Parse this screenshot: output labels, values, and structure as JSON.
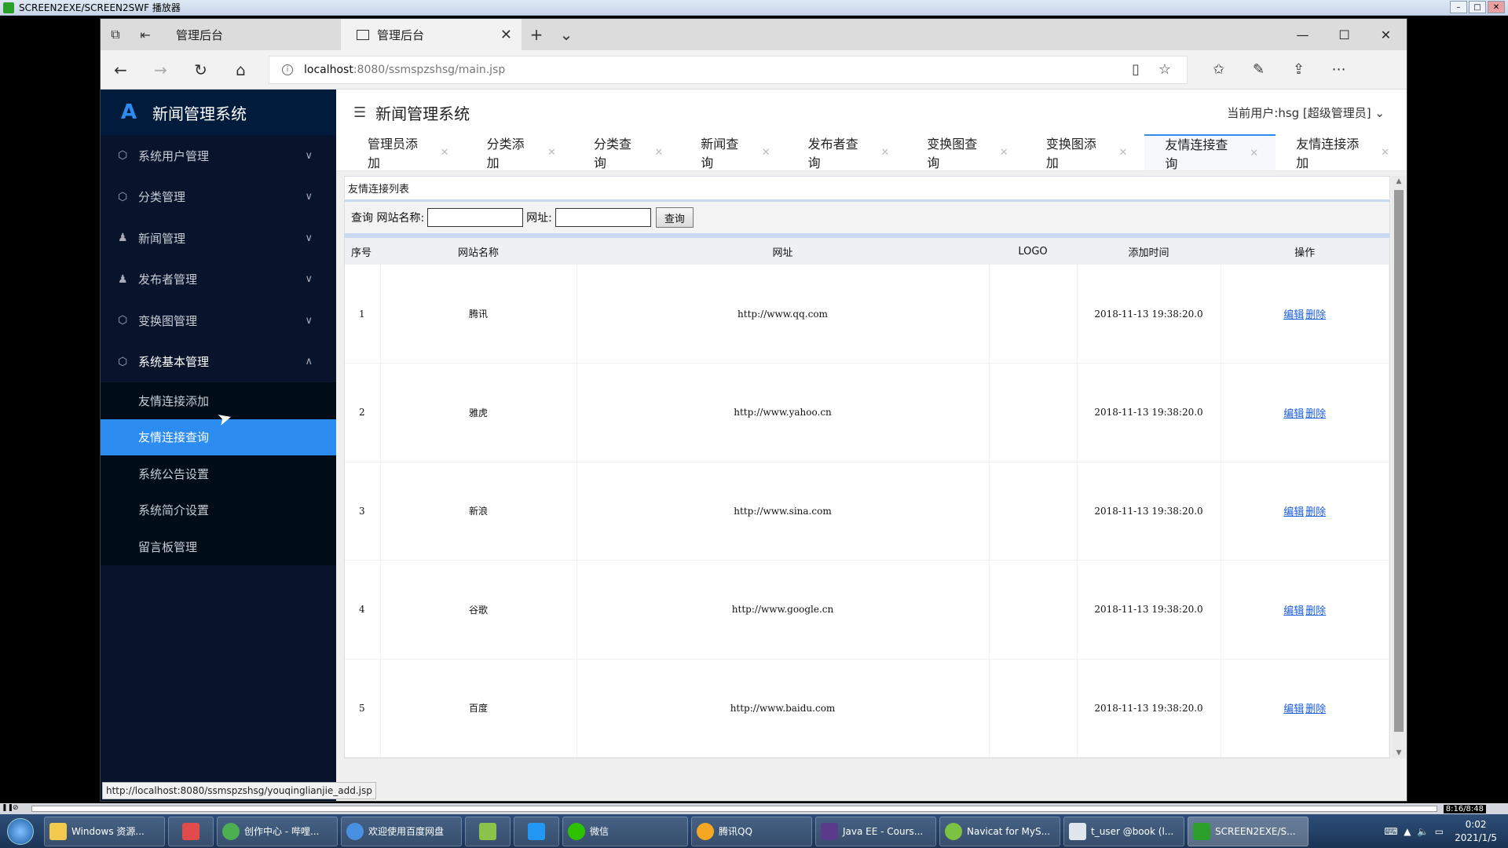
{
  "player": {
    "title": "SCREEN2EXE/SCREEN2SWF 播放器",
    "time": "8:16/8:48"
  },
  "browser": {
    "tabs": [
      {
        "label": "管理后台"
      },
      {
        "label": "管理后台"
      }
    ],
    "url_host": "localhost",
    "url_path": ":8080/ssmspzshsg/main.jsp",
    "status_url": "http://localhost:8080/ssmspzshsg/youqinglianjie_add.jsp"
  },
  "app": {
    "logo_text": "新闻管理系统",
    "header_title": "新闻管理系统",
    "current_user": "当前用户:hsg [超级管理员]",
    "menu": [
      {
        "label": "系统用户管理",
        "icon": "cube-icon"
      },
      {
        "label": "分类管理",
        "icon": "cube-icon"
      },
      {
        "label": "新闻管理",
        "icon": "user-icon"
      },
      {
        "label": "发布者管理",
        "icon": "user-icon"
      },
      {
        "label": "变换图管理",
        "icon": "cube-icon"
      },
      {
        "label": "系统基本管理",
        "icon": "cube-icon"
      }
    ],
    "submenu": [
      {
        "label": "友情连接添加"
      },
      {
        "label": "友情连接查询"
      },
      {
        "label": "系统公告设置"
      },
      {
        "label": "系统简介设置"
      },
      {
        "label": "留言板管理"
      }
    ],
    "nav_tabs": [
      {
        "label": "管理员添加"
      },
      {
        "label": "分类添加"
      },
      {
        "label": "分类查询"
      },
      {
        "label": "新闻查询"
      },
      {
        "label": "发布者查询"
      },
      {
        "label": "变换图查询"
      },
      {
        "label": "变换图添加"
      },
      {
        "label": "友情连接查询"
      },
      {
        "label": "友情连接添加"
      }
    ]
  },
  "list": {
    "panel_title": "友情连接列表",
    "search_prefix": "查询 网站名称:",
    "url_label": "网址:",
    "query_button": "查询",
    "columns": [
      "序号",
      "网站名称",
      "网址",
      "LOGO",
      "添加时间",
      "操作"
    ],
    "rows": [
      {
        "num": "1",
        "name": "腾讯",
        "url": "http://www.qq.com",
        "time": "2018-11-13 19:38:20.0"
      },
      {
        "num": "2",
        "name": "雅虎",
        "url": "http://www.yahoo.cn",
        "time": "2018-11-13 19:38:20.0"
      },
      {
        "num": "3",
        "name": "新浪",
        "url": "http://www.sina.com",
        "time": "2018-11-13 19:38:20.0"
      },
      {
        "num": "4",
        "name": "谷歌",
        "url": "http://www.google.cn",
        "time": "2018-11-13 19:38:20.0"
      },
      {
        "num": "5",
        "name": "百度",
        "url": "http://www.baidu.com",
        "time": "2018-11-13 19:38:20.0"
      }
    ],
    "edit_label": "编辑",
    "delete_label": "删除"
  },
  "taskbar": {
    "items": [
      {
        "label": "Windows 资源..."
      },
      {
        "label": ""
      },
      {
        "label": "创作中心 - 哔哩..."
      },
      {
        "label": "欢迎使用百度网盘"
      },
      {
        "label": ""
      },
      {
        "label": ""
      },
      {
        "label": "微信"
      },
      {
        "label": "腾讯QQ"
      },
      {
        "label": "Java EE - Cours..."
      },
      {
        "label": "Navicat for MyS..."
      },
      {
        "label": "t_user @book (l..."
      },
      {
        "label": "SCREEN2EXE/S..."
      }
    ],
    "clock_time": "0:02",
    "clock_date": "2021/1/5"
  }
}
